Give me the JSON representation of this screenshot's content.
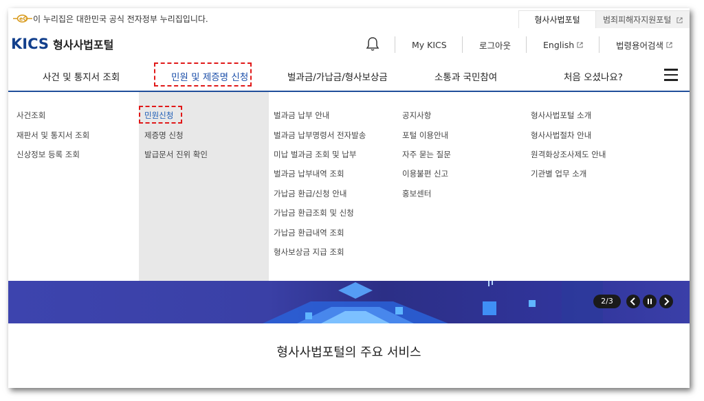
{
  "gov_bar": {
    "notice": "이 누리집은 대한민국 공식 전자정부 누리집입니다.",
    "tabs": [
      {
        "label": "형사사법포털",
        "active": true
      },
      {
        "label": "범죄피해자지원포털",
        "active": false
      }
    ]
  },
  "header": {
    "logo_mark": "KICS",
    "logo_text": "형사사법포털",
    "links": [
      "My KICS",
      "로그아웃",
      "English",
      "법령용어검색"
    ]
  },
  "gnb": {
    "items": [
      {
        "label": "사건 및 통지서 조회",
        "active": false
      },
      {
        "label": "민원 및 제증명 신청",
        "active": true
      },
      {
        "label": "벌과금/가납금/형사보상금",
        "active": false
      },
      {
        "label": "소통과 국민참여",
        "active": false
      },
      {
        "label": "처음 오셨나요?",
        "active": false
      }
    ]
  },
  "mega_menu": {
    "columns": [
      [
        "사건조회",
        "재판서 및 통지서 조회",
        "신상정보 등록 조회"
      ],
      [
        "민원신청",
        "제증명 신청",
        "발급문서 진위 확인"
      ],
      [
        "벌과금 납부 안내",
        "벌과금 납부명령서 전자발송",
        "미납 벌과금 조회 및 납부",
        "벌과금 납부내역 조회",
        "가납금 환급/신청 안내",
        "가납금 환급조회 및 신청",
        "가납금 환급내역 조회",
        "형사보상금 지급 조회"
      ],
      [
        "공지사항",
        "포털 이용안내",
        "자주 묻는 질문",
        "이용불편 신고",
        "홍보센터"
      ],
      [
        "형사사법포털 소개",
        "형사사법절차 안내",
        "원격화상조사제도 안내",
        "기관별 업무 소개"
      ]
    ]
  },
  "banner": {
    "page_indicator": "2/3"
  },
  "services": {
    "title": "형사사법포털의 주요 서비스"
  },
  "colors": {
    "brand": "#123f8c",
    "active_link": "#1b5bb5",
    "highlight": "#e01818"
  }
}
